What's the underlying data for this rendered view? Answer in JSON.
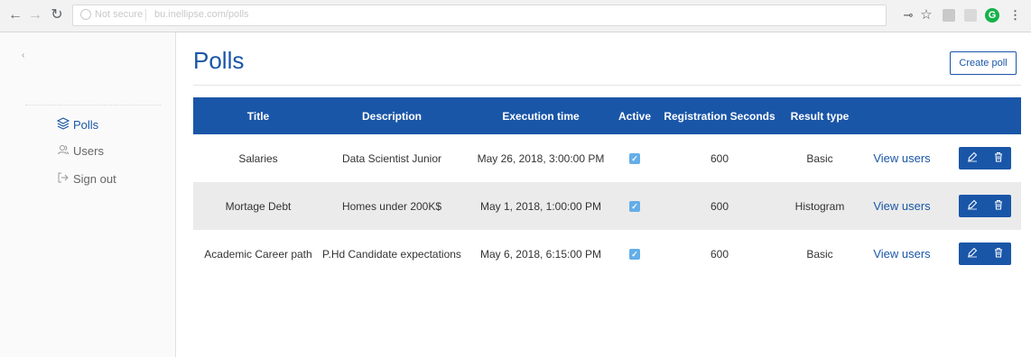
{
  "browser": {
    "security_label": "Not secure",
    "url": "bu.inellipse.com/polls"
  },
  "sidebar": {
    "items": [
      {
        "label": "Polls",
        "icon": "layers-icon"
      },
      {
        "label": "Users",
        "icon": "users-icon"
      },
      {
        "label": "Sign out",
        "icon": "sign-out-icon"
      }
    ]
  },
  "main": {
    "title": "Polls",
    "create_button": "Create poll"
  },
  "table": {
    "columns": [
      "Title",
      "Description",
      "Execution time",
      "Active",
      "Registration Seconds",
      "Result type"
    ],
    "rows": [
      {
        "title": "Salaries",
        "description": "Data Scientist Junior",
        "execution_time": "May 26, 2018, 3:00:00 PM",
        "active": true,
        "registration_seconds": "600",
        "result_type": "Basic",
        "view_label": "View users"
      },
      {
        "title": "Mortage Debt",
        "description": "Homes under 200K$",
        "execution_time": "May 1, 2018, 1:00:00 PM",
        "active": true,
        "registration_seconds": "600",
        "result_type": "Histogram",
        "view_label": "View users"
      },
      {
        "title": "Academic Career path",
        "description": "P.Hd Candidate expectations",
        "execution_time": "May 6, 2018, 6:15:00 PM",
        "active": true,
        "registration_seconds": "600",
        "result_type": "Basic",
        "view_label": "View users"
      }
    ]
  },
  "colors": {
    "primary": "#1a56a8",
    "checkbox": "#64aee8",
    "row_alt": "#ebebeb"
  }
}
